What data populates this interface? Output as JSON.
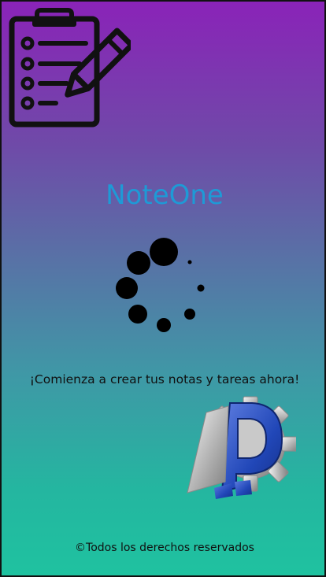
{
  "app": {
    "title": "NoteOne",
    "tagline": "¡Comienza a crear tus notas y tareas ahora!",
    "footer": "©Todos los derechos reservados"
  },
  "icons": {
    "top_left": "clipboard-checklist-pencil-icon",
    "loading": "loading-spinner-icon",
    "logo": "gear-d-logo"
  },
  "colors": {
    "title": "#1e9ad6",
    "gradient_top": "#8a23b8",
    "gradient_bottom": "#1fc2a0"
  }
}
